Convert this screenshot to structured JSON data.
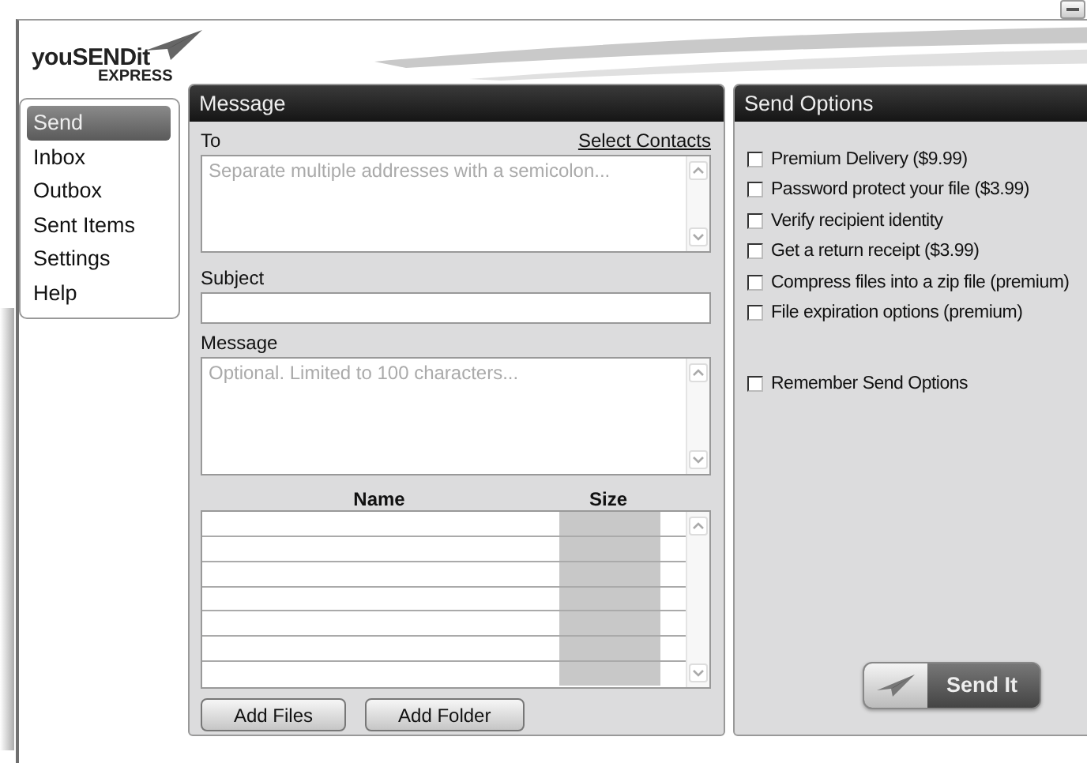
{
  "logo": {
    "name": "youSENDit",
    "sub": "EXPRESS"
  },
  "sidebar": {
    "items": [
      {
        "label": "Send",
        "selected": true
      },
      {
        "label": "Inbox",
        "selected": false
      },
      {
        "label": "Outbox",
        "selected": false
      },
      {
        "label": "Sent Items",
        "selected": false
      },
      {
        "label": "Settings",
        "selected": false
      },
      {
        "label": "Help",
        "selected": false
      }
    ]
  },
  "message_panel": {
    "title": "Message",
    "to_label": "To",
    "select_contacts": "Select Contacts",
    "to_placeholder": "Separate multiple addresses with a semicolon...",
    "subject_label": "Subject",
    "message_label": "Message",
    "message_placeholder": "Optional. Limited to 100 characters...",
    "files_table": {
      "columns": [
        "Name",
        "Size"
      ]
    },
    "buttons": [
      "Add Files",
      "Add Folder"
    ]
  },
  "send_options": {
    "title": "Send Options",
    "options": [
      {
        "label": "Premium Delivery ($9.99)",
        "checked": false
      },
      {
        "label": "Password protect your file ($3.99)",
        "checked": false
      },
      {
        "label": "Verify recipient identity",
        "checked": false
      },
      {
        "label": "Get a return receipt ($3.99)",
        "checked": false
      },
      {
        "label": "Compress files into a zip file (premium)",
        "checked": false
      },
      {
        "label": "File expiration options (premium)",
        "checked": false
      }
    ],
    "remember": {
      "label": "Remember Send Options",
      "checked": false
    },
    "send_button": "Send It"
  }
}
